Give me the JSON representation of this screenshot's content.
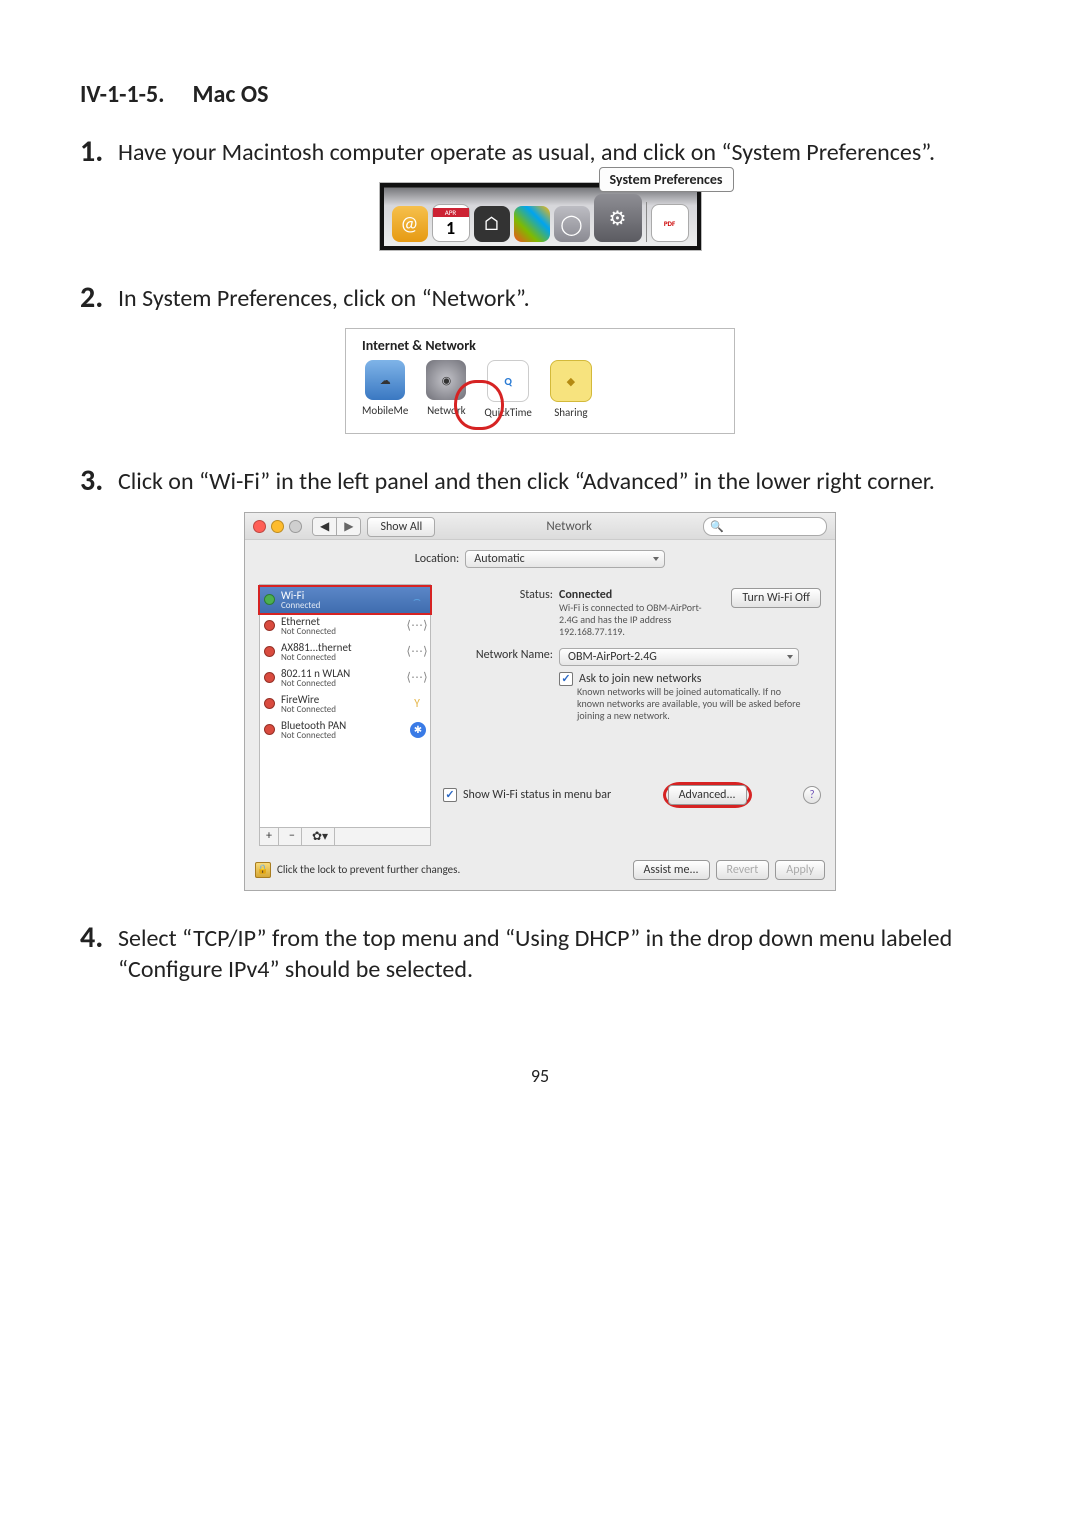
{
  "page_number": "95",
  "section": {
    "num": "IV-1-1-5.",
    "title": "Mac OS"
  },
  "steps": {
    "s1": {
      "num": "1.",
      "text": "Have your Macintosh computer operate as usual, and click on “System Preferences”."
    },
    "s2": {
      "num": "2.",
      "text": "In System Preferences, click on “Network”."
    },
    "s3": {
      "num": "3.",
      "text": "Click on “Wi-Fi” in the left panel and then click “Advanced” in the lower right corner."
    },
    "s4": {
      "num": "4.",
      "text": "Select “TCP/IP” from the top menu and “Using DHCP” in the drop down menu labeled “Configure IPv4” should be selected."
    }
  },
  "fig1": {
    "tooltip": "System Preferences",
    "cal_num": "1",
    "cal_top": "APR",
    "pdf_label": "PDF"
  },
  "fig2": {
    "title": "Internet & Network",
    "items": {
      "mobileme": "MobileMe",
      "network": "Network",
      "quicktime": "QuickTime",
      "sharing": "Sharing"
    }
  },
  "fig3": {
    "window_title": "Network",
    "show_all": "Show All",
    "location_label": "Location:",
    "location_value": "Automatic",
    "services": [
      {
        "name": "Wi-Fi",
        "sub": "Connected",
        "status": "green",
        "icon": "wifi",
        "selected": true
      },
      {
        "name": "Ethernet",
        "sub": "Not Connected",
        "status": "red",
        "icon": "eth",
        "selected": false
      },
      {
        "name": "AX881...thernet",
        "sub": "Not Connected",
        "status": "red",
        "icon": "eth",
        "selected": false
      },
      {
        "name": "802.11 n WLAN",
        "sub": "Not Connected",
        "status": "red",
        "icon": "eth",
        "selected": false
      },
      {
        "name": "FireWire",
        "sub": "Not Connected",
        "status": "red",
        "icon": "fw",
        "selected": false
      },
      {
        "name": "Bluetooth PAN",
        "sub": "Not Connected",
        "status": "red",
        "icon": "bt",
        "selected": false
      }
    ],
    "status_label": "Status:",
    "status_value": "Connected",
    "turn_off": "Turn Wi-Fi Off",
    "status_detail": "Wi-Fi is connected to OBM-AirPort-2.4G and has the IP address 192.168.77.119.",
    "netname_label": "Network Name:",
    "netname_value": "OBM-AirPort-2.4G",
    "ask_join": "Ask to join new networks",
    "ask_detail": "Known networks will be joined automatically. If no known networks are available, you will be asked before joining a new network.",
    "show_menu": "Show Wi-Fi status in menu bar",
    "advanced": "Advanced...",
    "lock_text": "Click the lock to prevent further changes.",
    "assist": "Assist me...",
    "revert": "Revert",
    "apply": "Apply"
  }
}
